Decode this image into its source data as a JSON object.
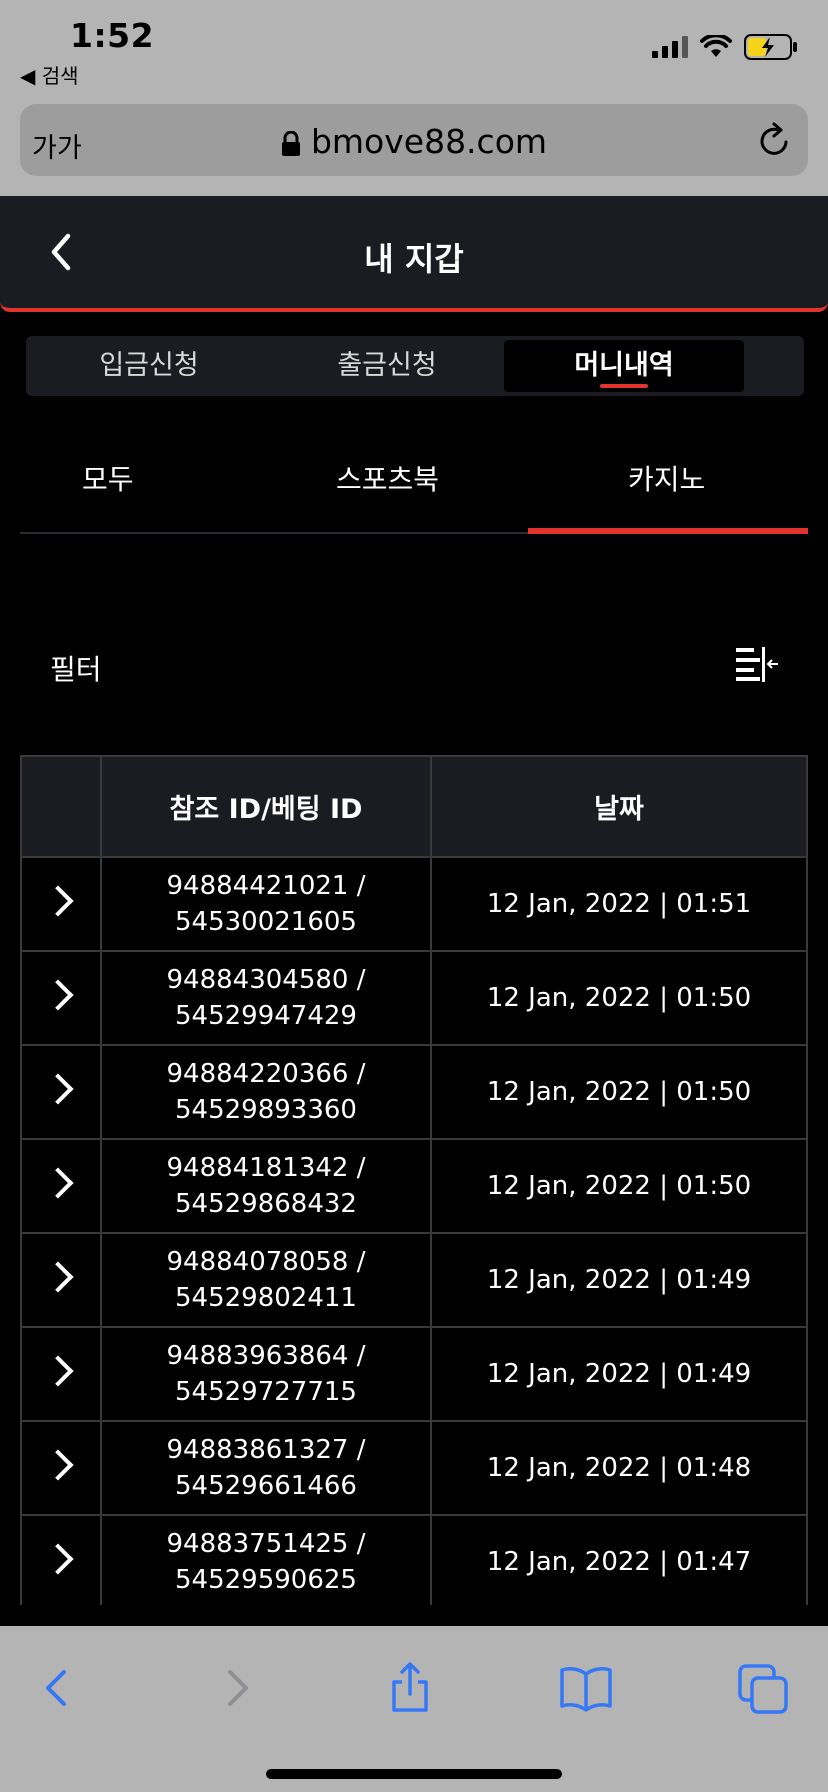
{
  "status_bar": {
    "time": "1:52",
    "back_app": "◀ 검색"
  },
  "browser": {
    "text_size": "가가",
    "url": "bmove88.com"
  },
  "header": {
    "title": "내 지갑"
  },
  "segments": [
    {
      "label": "입금신청",
      "active": false
    },
    {
      "label": "출금신청",
      "active": false
    },
    {
      "label": "머니내역",
      "active": true
    }
  ],
  "sub_tabs": [
    {
      "label": "모두",
      "active": false
    },
    {
      "label": "스포츠북",
      "active": false
    },
    {
      "label": "카지노",
      "active": true
    }
  ],
  "filter": {
    "label": "필터"
  },
  "table": {
    "headers": [
      "",
      "참조 ID/베팅 ID",
      "날짜"
    ],
    "rows": [
      {
        "ref_id": "94884421021 /",
        "bet_id": "54530021605",
        "date": "12 Jan, 2022 | 01:51"
      },
      {
        "ref_id": "94884304580 /",
        "bet_id": "54529947429",
        "date": "12 Jan, 2022 | 01:50"
      },
      {
        "ref_id": "94884220366 /",
        "bet_id": "54529893360",
        "date": "12 Jan, 2022 | 01:50"
      },
      {
        "ref_id": "94884181342 /",
        "bet_id": "54529868432",
        "date": "12 Jan, 2022 | 01:50"
      },
      {
        "ref_id": "94884078058 /",
        "bet_id": "54529802411",
        "date": "12 Jan, 2022 | 01:49"
      },
      {
        "ref_id": "94883963864 /",
        "bet_id": "54529727715",
        "date": "12 Jan, 2022 | 01:49"
      },
      {
        "ref_id": "94883861327 /",
        "bet_id": "54529661466",
        "date": "12 Jan, 2022 | 01:48"
      },
      {
        "ref_id": "94883751425 /",
        "bet_id": "54529590625",
        "date": "12 Jan, 2022 | 01:47"
      }
    ]
  },
  "colors": {
    "accent": "#e0342c",
    "header_bg": "#1b1c21",
    "ios_blue": "#3478f6"
  }
}
